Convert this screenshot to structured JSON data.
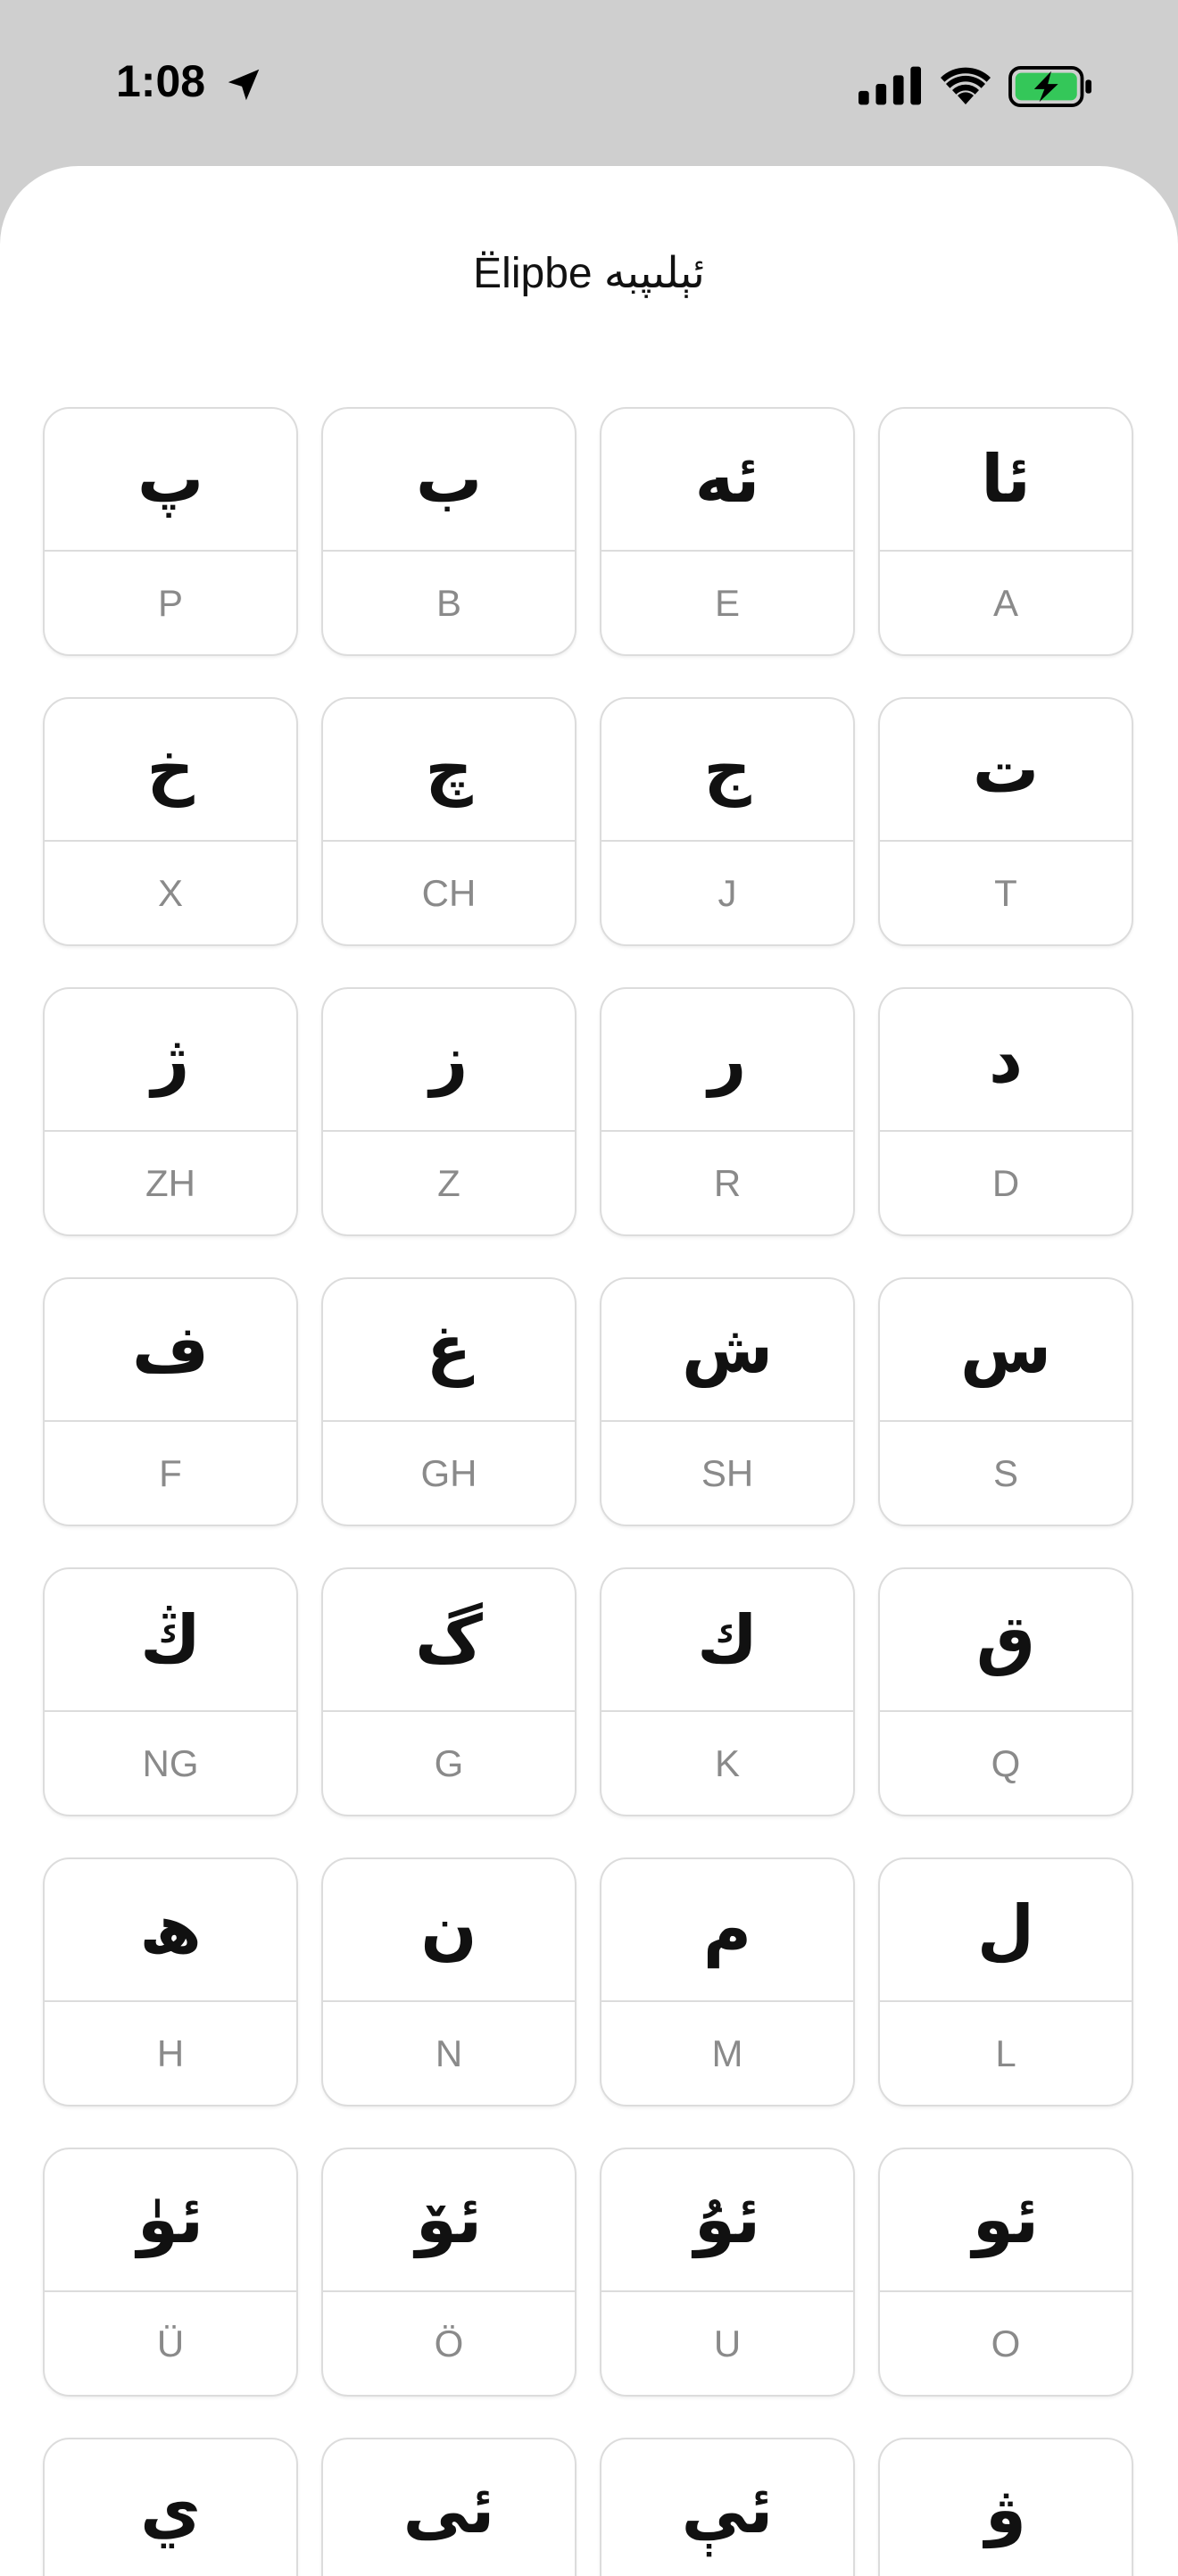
{
  "status_bar": {
    "time": "1:08"
  },
  "sheet": {
    "title": "Ëlipbe ئېلىپبە"
  },
  "letters": [
    {
      "arabic": "ئا",
      "latin": "A"
    },
    {
      "arabic": "ئە",
      "latin": "E"
    },
    {
      "arabic": "ب",
      "latin": "B"
    },
    {
      "arabic": "پ",
      "latin": "P"
    },
    {
      "arabic": "ت",
      "latin": "T"
    },
    {
      "arabic": "ج",
      "latin": "J"
    },
    {
      "arabic": "چ",
      "latin": "CH"
    },
    {
      "arabic": "خ",
      "latin": "X"
    },
    {
      "arabic": "د",
      "latin": "D"
    },
    {
      "arabic": "ر",
      "latin": "R"
    },
    {
      "arabic": "ز",
      "latin": "Z"
    },
    {
      "arabic": "ژ",
      "latin": "ZH"
    },
    {
      "arabic": "س",
      "latin": "S"
    },
    {
      "arabic": "ش",
      "latin": "SH"
    },
    {
      "arabic": "غ",
      "latin": "GH"
    },
    {
      "arabic": "ف",
      "latin": "F"
    },
    {
      "arabic": "ق",
      "latin": "Q"
    },
    {
      "arabic": "ك",
      "latin": "K"
    },
    {
      "arabic": "گ",
      "latin": "G"
    },
    {
      "arabic": "ڭ",
      "latin": "NG"
    },
    {
      "arabic": "ل",
      "latin": "L"
    },
    {
      "arabic": "م",
      "latin": "M"
    },
    {
      "arabic": "ن",
      "latin": "N"
    },
    {
      "arabic": "ھ",
      "latin": "H"
    },
    {
      "arabic": "ئو",
      "latin": "O"
    },
    {
      "arabic": "ئۇ",
      "latin": "U"
    },
    {
      "arabic": "ئۆ",
      "latin": "Ö"
    },
    {
      "arabic": "ئۈ",
      "latin": "Ü"
    },
    {
      "arabic": "ۋ",
      "latin": ""
    },
    {
      "arabic": "ئې",
      "latin": ""
    },
    {
      "arabic": "ئى",
      "latin": ""
    },
    {
      "arabic": "ي",
      "latin": ""
    }
  ],
  "colors": {
    "battery_green": "#34c759",
    "tile_border": "#dcdcdc",
    "latin_gray": "#8a8a8a"
  },
  "icons": [
    "location-arrow-icon",
    "cellular-signal-icon",
    "wifi-icon",
    "battery-charging-icon"
  ]
}
